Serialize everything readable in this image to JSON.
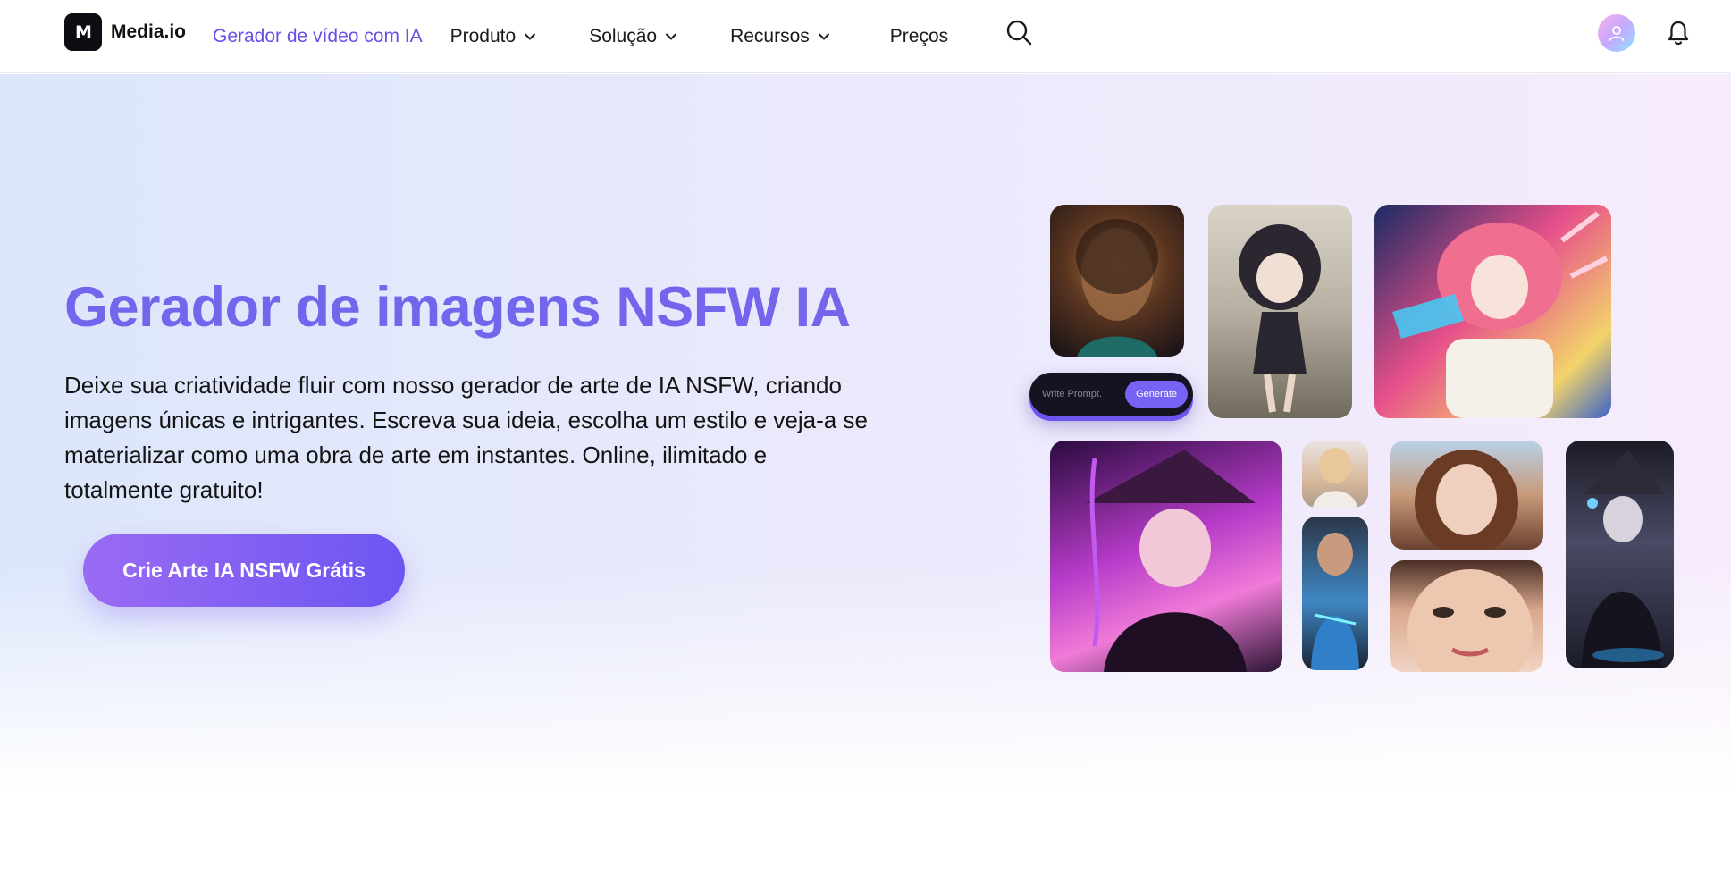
{
  "header": {
    "logo_text": "Media.io",
    "logo_mark": "M",
    "nav": [
      {
        "label": "Gerador de vídeo com IA"
      },
      {
        "label": "Produto"
      },
      {
        "label": "Solução"
      },
      {
        "label": "Recursos"
      },
      {
        "label": "Preços"
      }
    ],
    "icons": [
      "search-icon",
      "user-avatar",
      "bell-icon"
    ]
  },
  "hero": {
    "title": "Gerador de imagens NSFW IA",
    "description": "Deixe sua criatividade fluir com nosso gerador de arte de IA NSFW, criando imagens únicas e intrigantes. Escreva sua ideia, escolha um estilo e veja-a se materializar como uma obra de arte em instantes. Online, ilimitado e totalmente gratuito!",
    "cta_label": "Crie Arte IA NSFW Grátis",
    "prompt_placeholder": "Write Prompt.",
    "prompt_button": "Generate"
  },
  "colors": {
    "accent": "#7466ec",
    "nav_active": "#6a4ee8",
    "cta_start": "#9a6bf3",
    "cta_end": "#6d55f2"
  }
}
